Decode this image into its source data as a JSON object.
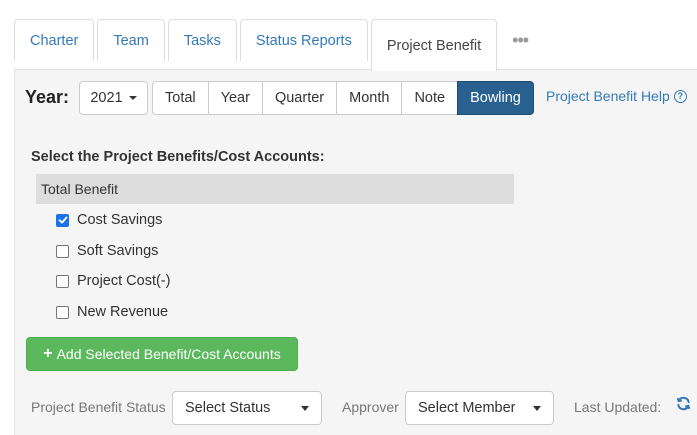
{
  "tabs": [
    {
      "label": "Charter",
      "active": false
    },
    {
      "label": "Team",
      "active": false
    },
    {
      "label": "Tasks",
      "active": false
    },
    {
      "label": "Status Reports",
      "active": false
    },
    {
      "label": "Project Benefit",
      "active": true
    }
  ],
  "tabs_more": "•••",
  "toolbar": {
    "year_label": "Year:",
    "year_value": "2021",
    "views": [
      {
        "label": "Total",
        "active": false
      },
      {
        "label": "Year",
        "active": false
      },
      {
        "label": "Quarter",
        "active": false
      },
      {
        "label": "Month",
        "active": false
      },
      {
        "label": "Note",
        "active": false
      },
      {
        "label": "Bowling",
        "active": true
      }
    ],
    "help_label": "Project Benefit Help",
    "help_icon": "?"
  },
  "benefits": {
    "title": "Select the Project Benefits/Cost Accounts:",
    "group_label": "Total Benefit",
    "items": [
      {
        "label": "Cost Savings",
        "checked": true
      },
      {
        "label": "Soft Savings",
        "checked": false
      },
      {
        "label": "Project Cost(-)",
        "checked": false
      },
      {
        "label": "New Revenue",
        "checked": false
      }
    ],
    "add_button_icon": "+",
    "add_button_label": "Add Selected Benefit/Cost Accounts"
  },
  "footer": {
    "status_label": "Project Benefit Status",
    "status_value": "Select Status",
    "approver_label": "Approver",
    "approver_value": "Select Member",
    "last_updated_label": "Last Updated:"
  },
  "colors": {
    "link": "#337ab7",
    "active_button": "#286090",
    "add_button": "#5cb85c",
    "checkbox_checked": "#1a73e8"
  }
}
